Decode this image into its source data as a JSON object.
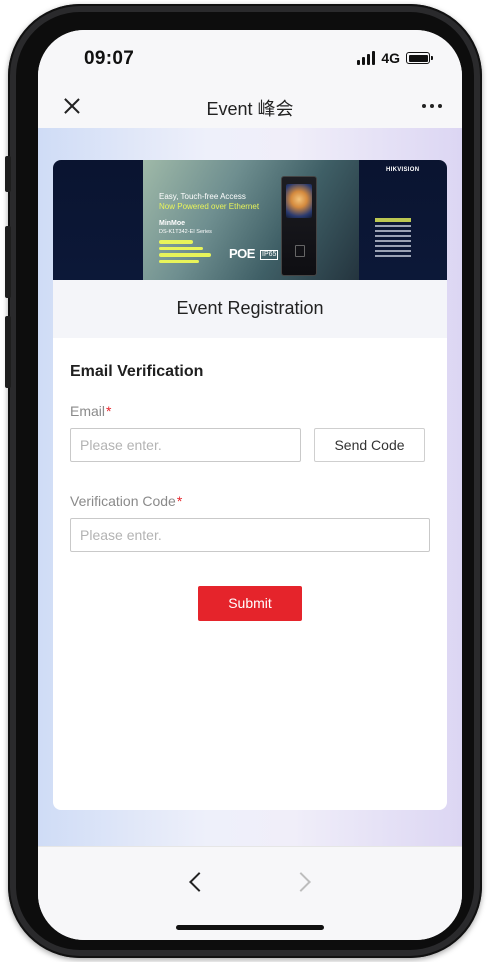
{
  "status_bar": {
    "time": "09:07",
    "network": "4G",
    "signal_icon": "signal-bars-icon",
    "battery_icon": "battery-icon"
  },
  "nav_bar": {
    "title": "Event 峰会",
    "close_icon": "close-icon",
    "more_icon": "more-icon"
  },
  "banner": {
    "brand": "HIKVISION",
    "headline_line1": "Easy, Touch-free Access",
    "headline_line2": "Now Powered over Ethernet",
    "product_name": "MinMoe",
    "model": "DS-K1T342-EI Series",
    "poe_label": "POE",
    "ip_label": "IP65"
  },
  "form": {
    "header_title": "Event Registration",
    "section_title": "Email Verification",
    "email_label": "Email",
    "email_placeholder": "Please enter.",
    "email_value": "",
    "send_code_label": "Send Code",
    "code_label": "Verification Code",
    "code_placeholder": "Please enter.",
    "code_value": "",
    "required_mark": "*",
    "submit_label": "Submit"
  },
  "colors": {
    "accent": "#e5242b",
    "required": "#e5242b",
    "banner_background": "#0a1430",
    "banner_highlight": "#e8f45a"
  },
  "toolbar": {
    "back_icon": "chevron-left-icon",
    "forward_icon": "chevron-right-icon",
    "forward_enabled": false
  }
}
